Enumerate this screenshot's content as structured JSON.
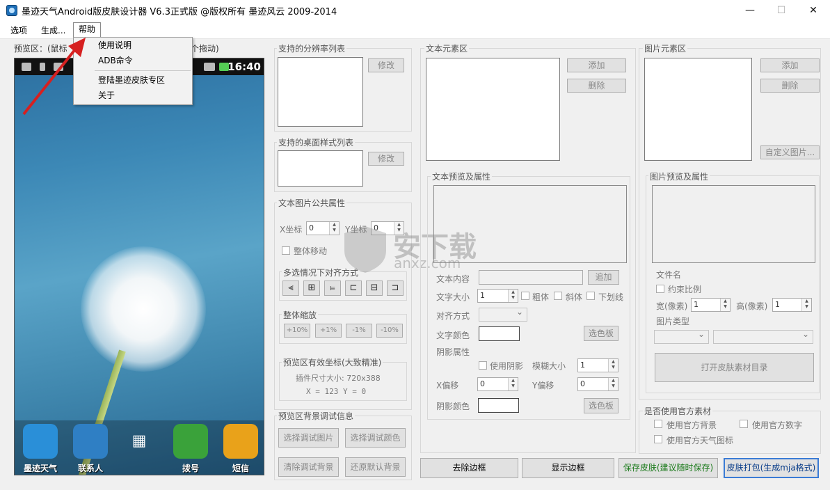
{
  "window": {
    "title": "墨迹天气Android版皮肤设计器 V6.3正式版 @版权所有 墨迹风云 2009-2014",
    "minimize": "—",
    "maximize": "☐",
    "close": "✕"
  },
  "menu": {
    "items": [
      "选项",
      "生成...",
      "帮助"
    ],
    "dropdown": [
      "使用说明",
      "ADB命令",
      "登陆墨迹皮肤专区",
      "关于"
    ]
  },
  "preview": {
    "label_left": "预览区：(鼠标",
    "label_right": "个拖动)",
    "clock": "16:40",
    "apps": [
      "墨迹天气",
      "联系人",
      "拨号",
      "短信"
    ]
  },
  "resolution": {
    "title": "支持的分辨率列表",
    "edit": "修改"
  },
  "desktop_style": {
    "title": "支持的桌面样式列表",
    "edit": "修改"
  },
  "common_props": {
    "title": "文本图片公共属性",
    "x_label": "X坐标",
    "x_value": "0",
    "y_label": "Y坐标",
    "y_value": "0",
    "move_all": "整体移动",
    "align_title": "多选情况下对齐方式",
    "scale_title": "整体缩放",
    "scale_buttons": [
      "+10%",
      "+1%",
      "-1%",
      "-10%"
    ],
    "coord_title": "预览区有效坐标(大致精准)",
    "plugin_size": "插件尺寸大小: 720x388",
    "coords": "X = 123    Y = 0"
  },
  "bg_debug": {
    "title": "预览区背景调试信息",
    "buttons": [
      "选择调试图片",
      "选择调试颜色",
      "清除调试背景",
      "还原默认背景"
    ]
  },
  "text_elements": {
    "title": "文本元素区",
    "add": "添加",
    "delete": "删除",
    "preview_title": "文本预览及属性",
    "content_label": "文本内容",
    "content_add": "追加",
    "size_label": "文字大小",
    "size_value": "1",
    "bold": "粗体",
    "italic": "斜体",
    "underline": "下划线",
    "align_label": "对齐方式",
    "color_label": "文字颜色",
    "palette": "选色板",
    "shadow_label": "阴影属性",
    "use_shadow": "使用阴影",
    "blur_label": "模糊大小",
    "blur_value": "1",
    "xoff_label": "X偏移",
    "xoff_value": "0",
    "yoff_label": "Y偏移",
    "yoff_value": "0",
    "shadow_color_label": "阴影颜色",
    "shadow_palette": "选色板"
  },
  "image_elements": {
    "title": "图片元素区",
    "add": "添加",
    "delete": "删除",
    "custom": "自定义图片...",
    "preview_title": "图片预览及属性",
    "filename_label": "文件名",
    "keep_ratio": "约束比例",
    "width_label": "宽(像素)",
    "width_value": "1",
    "height_label": "高(像素)",
    "height_value": "1",
    "type_label": "图片类型",
    "open_dir": "打开皮肤素材目录"
  },
  "official": {
    "title": "是否使用官方素材",
    "bg": "使用官方背景",
    "digits": "使用官方数字",
    "weather_icons": "使用官方天气图标"
  },
  "bottom": {
    "remove_border": "去除边框",
    "show_border": "显示边框",
    "save": "保存皮肤(建议随时保存)",
    "pack": "皮肤打包(生成mja格式)"
  },
  "watermark": {
    "text1": "安下载",
    "text2": "anxz.com"
  },
  "colors": {
    "save_text": "#1a7a1a",
    "pack_text": "#0b3e8a",
    "arrow": "#d62020"
  }
}
